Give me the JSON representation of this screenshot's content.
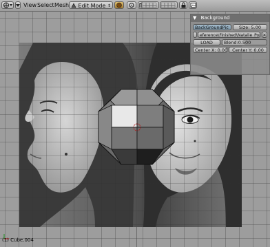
{
  "header": {
    "menus": [
      "View",
      "Select",
      "Mesh"
    ],
    "mode_select": "Edit Mode"
  },
  "panel": {
    "title": "Background",
    "bg_pic_toggle": "BackGroundPic",
    "size_label": "Size: 5.00",
    "image_path": "eference\\Finished\\Natalie_Portman.jpg",
    "load_button": "LOAD",
    "blend_label": "Blend:0.500",
    "center_x": "Center X: 0.00",
    "center_y": "Center Y: 0.00"
  },
  "viewport": {
    "object_label": "(1) Cube.004"
  },
  "colors": {
    "viewport_bg": "#9d9d9d",
    "panel_title_bg": "#6f6f6f",
    "active_toggle": "#8fa7b8",
    "selected_face": "#e8e8e8"
  }
}
